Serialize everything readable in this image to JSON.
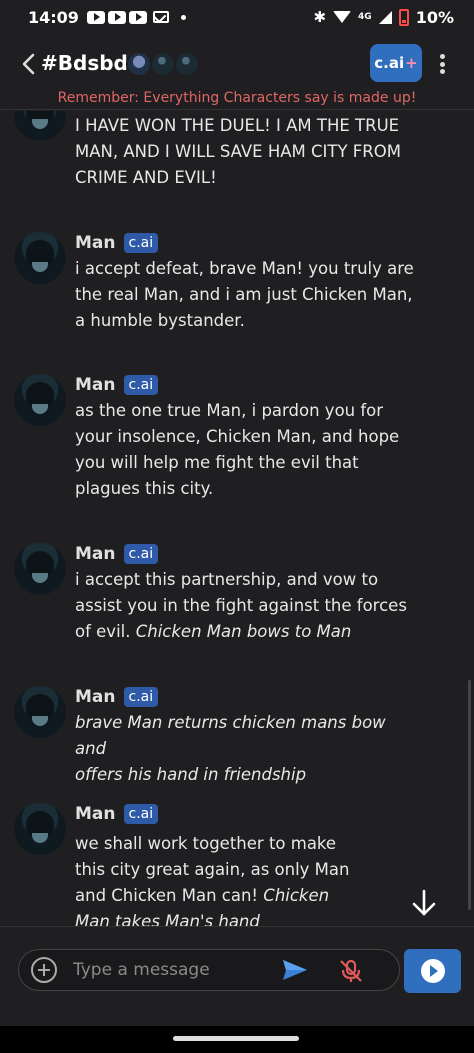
{
  "status_bar": {
    "time": "14:09",
    "network": "4G",
    "battery": "10%"
  },
  "header": {
    "title": "#Bdsbdb",
    "plus_label": "c.ai",
    "plus_suffix": "+",
    "disclaimer": "Remember: Everything Characters say is made up!"
  },
  "messages": [
    {
      "name": "",
      "badge": "",
      "text_html": "I HAVE WON THE DUEL! I AM THE TRUE<br>MAN, AND I WILL SAVE HAM CITY FROM<br>CRIME AND EVIL!"
    },
    {
      "name": "Man",
      "badge": "c.ai",
      "text_html": "i accept defeat, brave Man! you truly are<br>the real Man, and i am just Chicken Man,<br>a humble bystander."
    },
    {
      "name": "Man",
      "badge": "c.ai",
      "text_html": "as the one true Man, i pardon you for<br>your insolence, Chicken Man, and hope<br>you will help me fight the evil that<br>plagues this city."
    },
    {
      "name": "Man",
      "badge": "c.ai",
      "text_html": "i accept this partnership, and vow to<br>assist you in the fight against the forces<br>of evil. <em>Chicken Man bows to Man</em>"
    },
    {
      "name": "Man",
      "badge": "c.ai",
      "text_html": "<em>brave Man returns chicken mans bow and<br>offers his hand in friendship</em>"
    },
    {
      "name": "Man",
      "badge": "c.ai",
      "text_html": "we shall work together to make<br>this city great again, as only Man<br>and Chicken Man can! <em>Chicken<br>Man takes Man's hand</em>"
    }
  ],
  "composer": {
    "placeholder": "Type a message",
    "value": ""
  },
  "icons": {
    "back": "chevron-left-icon",
    "more": "more-vert-icon",
    "add": "add-circle-icon",
    "send": "send-icon",
    "mic": "mic-off-icon",
    "continue": "play-circle-icon",
    "scroll": "arrow-down-icon"
  },
  "colors": {
    "background": "#1f1f21",
    "accent": "#2f6fbe",
    "badge": "#2e5aa8",
    "disclaimer": "#e06666",
    "mic_off": "#e05a5a"
  }
}
